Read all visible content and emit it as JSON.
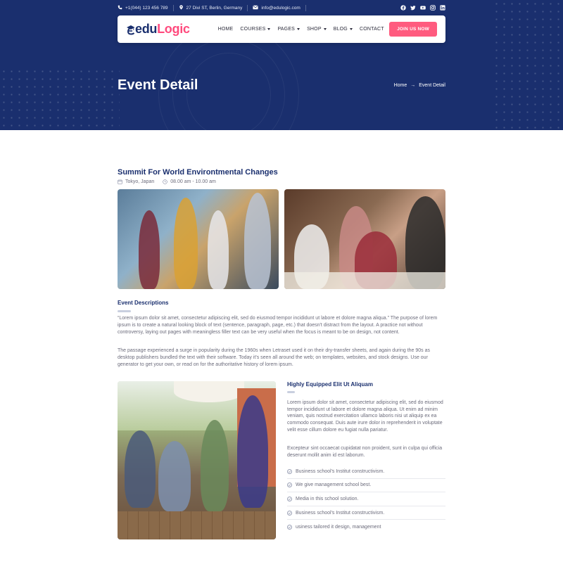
{
  "topbar": {
    "phone": "+1(044) 123 456 789",
    "address": "27 Divi ST, Berlin, Germany",
    "email": "info@edulogic.com",
    "social": [
      "facebook-icon",
      "twitter-icon",
      "youtube-icon",
      "instagram-icon",
      "linkedin-icon"
    ]
  },
  "nav": {
    "logo_prefix": "edu",
    "logo_suffix": "Logic",
    "items": [
      {
        "label": "HOME",
        "dropdown": false
      },
      {
        "label": "COURSES",
        "dropdown": true
      },
      {
        "label": "PAGES",
        "dropdown": true
      },
      {
        "label": "SHOP",
        "dropdown": true
      },
      {
        "label": "BLOG",
        "dropdown": true
      },
      {
        "label": "CONTACT",
        "dropdown": false
      }
    ],
    "cta": "JOIN US NOW"
  },
  "hero": {
    "title": "Event Detail",
    "breadcrumb_home": "Home",
    "breadcrumb_arrow": "→",
    "breadcrumb_current": "Event Detail"
  },
  "event": {
    "title": "Summit For World Environtmental Changes",
    "location": "Tokyo, Japan",
    "time": "08.00 am - 10.00 am"
  },
  "descriptions": {
    "heading": "Event Descriptions",
    "p1": "“Lorem ipsum dolor sit amet, consectetur adipiscing elit, sed do eiusmod tempor incididunt ut labore et dolore magna aliqua.” The purpose of lorem ipsum is to create a natural looking block of text (sentence, paragraph, page, etc.) that doesn't distract from the layout. A practice not without controversy, laying out pages with meaningless filler text can be very useful when the focus is meant to be on design, not content.",
    "p2": "The passage experienced a surge in popularity during the 1960s when Letraset used it on their dry-transfer sheets, and again during the 90s as desktop publishers bundled the text with their software. Today it's seen all around the web; on templates, websites, and stock designs. Use our generator to get your own, or read on for the authoritative history of lorem ipsum."
  },
  "side": {
    "heading": "Highly Equipped Elit Ut Aliquam",
    "p1": "Lorem ipsum dolor sit amet, consectetur adipiscing elit, sed do eiusmod tempor incididunt ut labore et dolore magna aliqua. Ut enim ad minim veniam, quis nostrud exercitation ullamco laboris nisi ut aliquip ex ea commodo consequat. Duis aute irure dolor in reprehenderit in voluptate velit esse cillum dolore eu fugiat nulla pariatur.",
    "p2": "Excepteur sint occaecat cupidatat non proident, sunt in culpa qui officia deserunt mollit anim id est laborum.",
    "list": [
      "Business school's Institut constructivism.",
      "We give management school best.",
      "Media in this school solution.",
      "Business school's Institut constructivism.",
      "usiness tailored it design, management"
    ]
  }
}
